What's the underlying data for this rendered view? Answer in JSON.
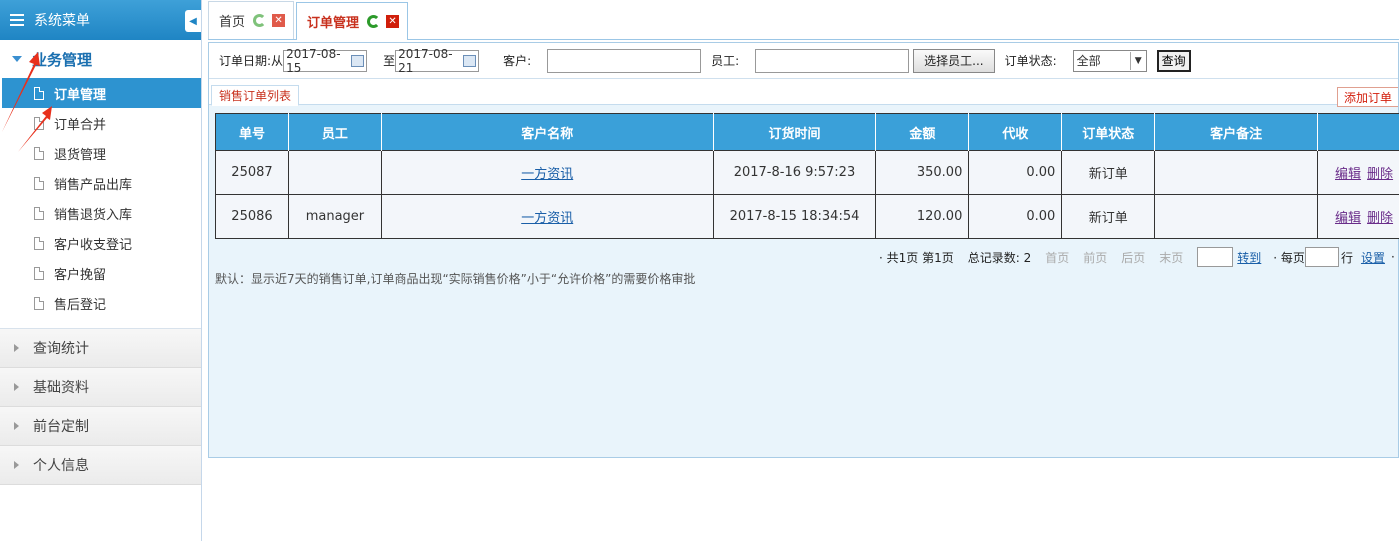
{
  "sidebar": {
    "title": "系统菜单",
    "open_group": "业务管理",
    "items": [
      "订单管理",
      "订单合并",
      "退货管理",
      "销售产品出库",
      "销售退货入库",
      "客户收支登记",
      "客户挽留",
      "售后登记"
    ],
    "groups": [
      "查询统计",
      "基础资料",
      "前台定制",
      "个人信息"
    ]
  },
  "tabs": {
    "home": "首页",
    "orders": "订单管理"
  },
  "search": {
    "date_label": "订单日期:",
    "from_label": "从",
    "from_date": "2017-08-15",
    "to_label": "至",
    "to_date": "2017-08-21",
    "customer_label": "客户:",
    "customer_value": "",
    "staff_label": "员工:",
    "staff_value": "",
    "select_staff": "选择员工...",
    "status_label": "订单状态:",
    "status_value": "全部",
    "query": "查询"
  },
  "subtab": {
    "label": "销售订单列表",
    "add": "添加订单"
  },
  "table": {
    "headers": [
      "单号",
      "员工",
      "客户名称",
      "订货时间",
      "金额",
      "代收",
      "订单状态",
      "客户备注",
      ""
    ],
    "rows": [
      {
        "id": "25087",
        "staff": "",
        "customer": "一方资讯",
        "time": "2017-8-16 9:57:23",
        "amount": "350.00",
        "cod": "0.00",
        "status": "新订单",
        "remark": "",
        "edit": "编辑",
        "delete": "删除"
      },
      {
        "id": "25086",
        "staff": "manager",
        "customer": "一方资讯",
        "time": "2017-8-15 18:34:54",
        "amount": "120.00",
        "cod": "0.00",
        "status": "新订单",
        "remark": "",
        "edit": "编辑",
        "delete": "删除"
      }
    ]
  },
  "pager": {
    "summary": "· 共1页 第1页",
    "total": "总记录数: 2",
    "first": "首页",
    "prev": "前页",
    "next": "后页",
    "last": "末页",
    "goto": "转到",
    "per_page": "· 每页",
    "rows_unit": "行",
    "settings": "设置",
    "dot": "·"
  },
  "note": "默认：显示近7天的销售订单,订单商品出现“实际销售价格”小于“允许价格”的需要价格审批"
}
